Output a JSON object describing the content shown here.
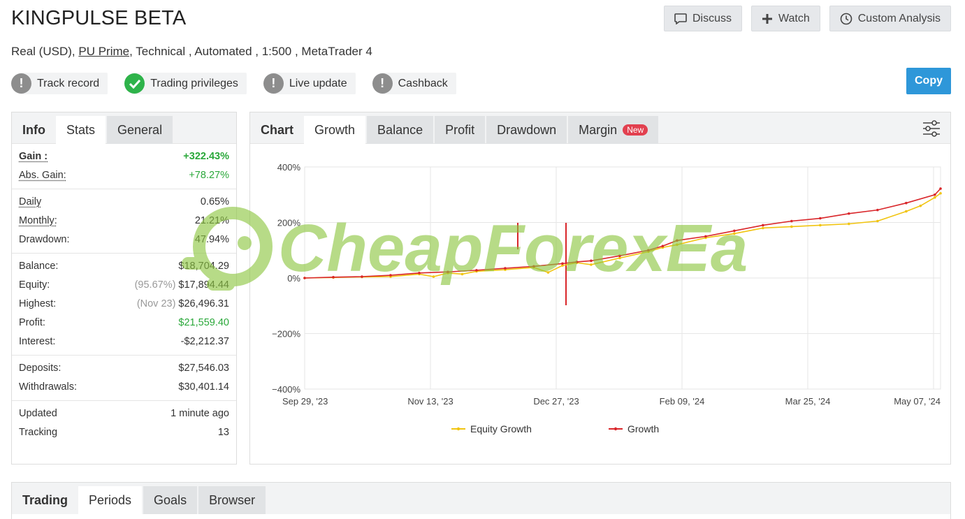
{
  "header": {
    "title": "KINGPULSE BETA",
    "account_type": "Real (USD),",
    "broker": "PU Prime",
    "details": ", Technical , Automated , 1:500 , MetaTrader 4"
  },
  "actions": {
    "discuss": "Discuss",
    "watch": "Watch",
    "custom_analysis": "Custom Analysis",
    "copy": "Copy"
  },
  "badges": [
    {
      "label": "Track record",
      "status": "unverified"
    },
    {
      "label": "Trading privileges",
      "status": "verified"
    },
    {
      "label": "Live update",
      "status": "unverified"
    },
    {
      "label": "Cashback",
      "status": "unverified"
    }
  ],
  "stats_tabs": [
    "Info",
    "Stats",
    "General"
  ],
  "stats": {
    "gain_label": "Gain :",
    "gain": "+322.43%",
    "abs_gain_label": "Abs. Gain:",
    "abs_gain": "+78.27%",
    "daily_label": "Daily",
    "daily": "0.65%",
    "monthly_label": "Monthly:",
    "monthly": "21.21%",
    "drawdown_label": "Drawdown:",
    "drawdown": "47.94%",
    "balance_label": "Balance:",
    "balance": "$18,704.29",
    "equity_label": "Equity:",
    "equity_pct": "(95.67%)",
    "equity": "$17,894.44",
    "highest_label": "Highest:",
    "highest_date": "(Nov 23)",
    "highest": "$26,496.31",
    "profit_label": "Profit:",
    "profit": "$21,559.40",
    "interest_label": "Interest:",
    "interest": "-$2,212.37",
    "deposits_label": "Deposits:",
    "deposits": "$27,546.03",
    "withdrawals_label": "Withdrawals:",
    "withdrawals": "$30,401.14",
    "updated_label": "Updated",
    "updated": "1 minute ago",
    "tracking_label": "Tracking",
    "tracking": "13"
  },
  "chart_tabs": {
    "lead": "Chart",
    "growth": "Growth",
    "balance": "Balance",
    "profit": "Profit",
    "drawdown": "Drawdown",
    "margin": "Margin",
    "new_badge": "New"
  },
  "bottom_tabs": [
    "Trading",
    "Periods",
    "Goals",
    "Browser"
  ],
  "watermark": "CheapForexEa",
  "colors": {
    "growth": "#d9262a",
    "equity_growth": "#f1c40f",
    "positive": "#2aa83a",
    "primary_button": "#2e97d9"
  },
  "chart_data": {
    "type": "line",
    "x_ticks": [
      "Sep 29, '23",
      "Nov 13, '23",
      "Dec 27, '23",
      "Feb 09, '24",
      "Mar 25, '24",
      "May 07, '24"
    ],
    "y_ticks": [
      "400%",
      "200%",
      "0%",
      "−200%",
      "−400%"
    ],
    "ylim": [
      -400,
      400
    ],
    "legend": [
      "Equity Growth",
      "Growth"
    ],
    "series": [
      {
        "name": "Growth",
        "color": "#d9262a",
        "x": [
          0,
          10,
          20,
          30,
          40,
          50,
          60,
          70,
          80,
          90,
          95,
          100,
          110,
          120,
          125,
          130,
          140,
          150,
          160,
          170,
          180,
          190,
          200,
          210,
          220,
          222
        ],
        "y": [
          0,
          3,
          5,
          10,
          18,
          22,
          28,
          35,
          42,
          52,
          58,
          62,
          80,
          100,
          115,
          135,
          150,
          170,
          190,
          205,
          215,
          232,
          245,
          270,
          300,
          322
        ]
      },
      {
        "name": "Equity Growth",
        "color": "#f1c40f",
        "x": [
          0,
          10,
          20,
          30,
          40,
          45,
          50,
          55,
          60,
          70,
          80,
          85,
          90,
          95,
          100,
          110,
          120,
          125,
          130,
          140,
          150,
          160,
          170,
          180,
          190,
          200,
          210,
          215,
          220,
          222
        ],
        "y": [
          0,
          2,
          4,
          5,
          14,
          5,
          18,
          14,
          24,
          30,
          38,
          20,
          45,
          55,
          48,
          72,
          95,
          110,
          120,
          145,
          160,
          180,
          185,
          190,
          195,
          205,
          240,
          260,
          290,
          305
        ]
      }
    ]
  }
}
